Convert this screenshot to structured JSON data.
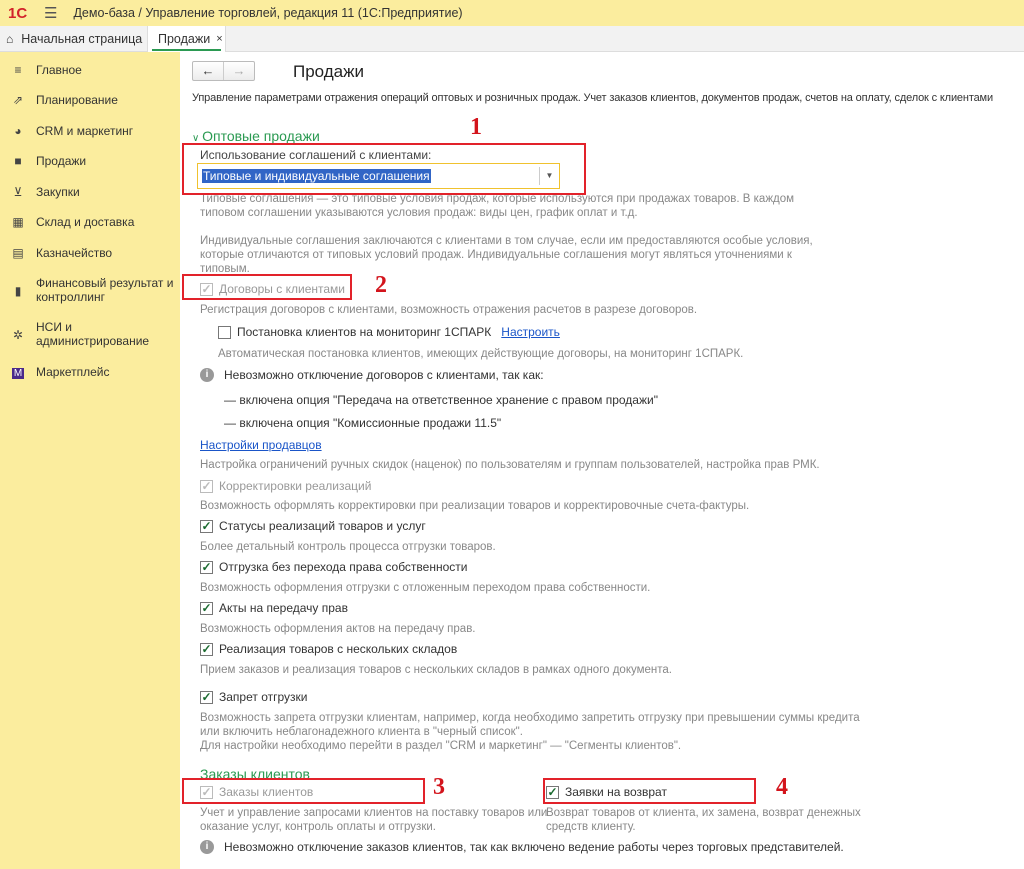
{
  "app": {
    "title": "Демо-база / Управление торговлей, редакция 11  (1С:Предприятие)",
    "logo": "1С"
  },
  "tabs": [
    {
      "label": "Начальная страница"
    },
    {
      "label": "Продажи",
      "close": "×"
    }
  ],
  "sidebar": {
    "items": [
      {
        "label": "Главное",
        "icon": "menu-icon"
      },
      {
        "label": "Планирование",
        "icon": "chart-icon"
      },
      {
        "label": "CRM и маркетинг",
        "icon": "pie-icon"
      },
      {
        "label": "Продажи",
        "icon": "bag-icon"
      },
      {
        "label": "Закупки",
        "icon": "cart-icon"
      },
      {
        "label": "Склад и доставка",
        "icon": "grid-icon"
      },
      {
        "label": "Казначейство",
        "icon": "coins-icon"
      },
      {
        "label": "Финансовый результат и",
        "label2": "контроллинг",
        "icon": "bar-chart-icon"
      },
      {
        "label": "НСИ и",
        "label2": "администрирование",
        "icon": "gear-icon"
      },
      {
        "label": "Маркетплейс",
        "icon": "marketplace-icon"
      }
    ]
  },
  "page": {
    "title": "Продажи",
    "description": "Управление параметрами отражения операций оптовых и розничных продаж. Учет заказов клиентов, документов продаж, счетов на оплату, сделок с клиентами",
    "wholesale": {
      "header": "Оптовые продажи",
      "agreements_label": "Использование соглашений с клиентами:",
      "agreements_value": "Типовые и индивидуальные соглашения",
      "agreements_help": [
        "Типовые соглашения — это типовые условия продаж, которые используются при продажах товаров. В каждом",
        "типовом соглашении указываются условия продаж: виды цен, график оплат и т.д.",
        "Индивидуальные соглашения заключаются с клиентами в том случае, если им предоставляются особые условия,",
        "которые отличаются от типовых условий продаж. Индивидуальные соглашения могут являться уточнениями к",
        "типовым."
      ],
      "contracts_label": "Договоры с клиентами",
      "contracts_help": "Регистрация договоров с клиентами, возможность отражения расчетов в разрезе договоров.",
      "spark_label": "Постановка клиентов на мониторинг 1СПАРК",
      "spark_link": "Настроить",
      "spark_help": "Автоматическая постановка клиентов, имеющих действующие договоры, на мониторинг 1СПАРК.",
      "contracts_info": "Невозможно отключение договоров с клиентами, так как:",
      "contracts_info_1": "— включена опция \"Передача на ответственное хранение с правом продажи\"",
      "contracts_info_2": "— включена опция \"Комиссионные продажи 11.5\"",
      "sellers_link": "Настройки продавцов",
      "sellers_help": "Настройка ограничений ручных скидок (наценок) по пользователям и группам пользователей, настройка прав РМК.",
      "options": [
        {
          "label": "Корректировки реализаций",
          "help": "Возможность оформлять корректировки при реализации товаров и корректировочные счета-фактуры.",
          "checked": true,
          "disabled": true
        },
        {
          "label": "Статусы реализаций товаров и услуг",
          "help": "Более детальный контроль процесса отгрузки товаров.",
          "checked": true
        },
        {
          "label": "Отгрузка без перехода права собственности",
          "help": "Возможность оформления отгрузки с отложенным переходом права собственности.",
          "checked": true
        },
        {
          "label": "Акты на передачу прав",
          "help": "Возможность оформления актов на передачу прав.",
          "checked": true
        },
        {
          "label": "Реализация товаров с нескольких складов",
          "help": "Прием заказов и реализация товаров с нескольких складов в рамках одного документа.",
          "checked": true
        },
        {
          "label": "Запрет отгрузки",
          "help": "Возможность запрета отгрузки клиентам, например, когда необходимо запретить отгрузку при превышении суммы кредита",
          "help2": "или включить неблагонадежного клиента в \"черный список\".",
          "help3": "Для настройки необходимо перейти в раздел \"CRM и маркетинг\" — \"Сегменты клиентов\".",
          "checked": true
        }
      ]
    },
    "orders": {
      "header": "Заказы клиентов",
      "orders_label": "Заказы клиентов",
      "orders_help": "Учет и управление запросами клиентов на поставку товаров или",
      "orders_help2": "оказание услуг, контроль оплаты и отгрузки.",
      "returns_label": "Заявки на возврат",
      "returns_help": "Возврат товаров от клиента, их замена, возврат денежных",
      "returns_help2": "средств клиенту.",
      "info": "Невозможно отключение заказов клиентов, так как включено ведение работы через торговых представителей."
    }
  },
  "annotations": [
    "1",
    "2",
    "3",
    "4"
  ]
}
